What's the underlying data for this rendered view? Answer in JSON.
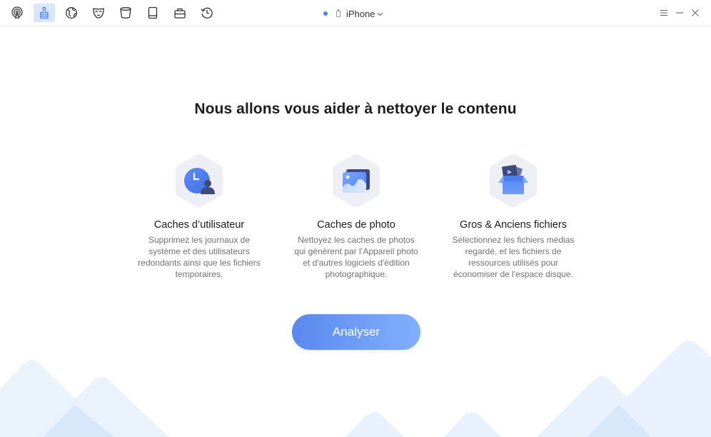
{
  "toolbar": {
    "nav_items": [
      {
        "name": "airplay-icon",
        "label": "Quick Access"
      },
      {
        "name": "cleaner-brush-icon",
        "label": "Cleaner",
        "active": true
      },
      {
        "name": "globe-icon",
        "label": "Browser"
      },
      {
        "name": "mask-icon",
        "label": "Privacy"
      },
      {
        "name": "trash-bin-icon",
        "label": "Eraser"
      },
      {
        "name": "tablet-icon",
        "label": "Device"
      },
      {
        "name": "toolbox-icon",
        "label": "Toolbox"
      },
      {
        "name": "history-icon",
        "label": "History"
      }
    ],
    "device": {
      "status_color": "#4c82f0",
      "name": "iPhone"
    },
    "window_controls": [
      "menu-icon",
      "minimize-icon",
      "close-icon"
    ]
  },
  "main": {
    "headline": "Nous allons vous aider à nettoyer le contenu",
    "features": [
      {
        "icon": "user-cache-clock-icon",
        "title": "Caches d’utilisateur",
        "description": "Supprimez les journaux de système et des utilisateurs redondants ainsi que les fichiers temporaires."
      },
      {
        "icon": "photo-cache-icon",
        "title": "Caches de photo",
        "description": "Nettoyez les caches de photos qui génèrent par l’Appareil photo et d'autres logiciels d'édition photographique."
      },
      {
        "icon": "large-old-files-box-icon",
        "title": "Gros & Anciens fichiers",
        "description": "Sélectionnez les fichiers médias regardé, et les fichiers de ressources utilisés pour économiser de l'espace disque."
      }
    ],
    "analyze_button": "Analyser"
  },
  "colors": {
    "accent": "#4c82f0",
    "button_gradient_start": "#5a88ee",
    "button_gradient_end": "#82b0fd",
    "active_nav_bg": "#dae6fb",
    "hexagon_bg": "#eeeff4",
    "mountain": "#e9f1fc"
  }
}
